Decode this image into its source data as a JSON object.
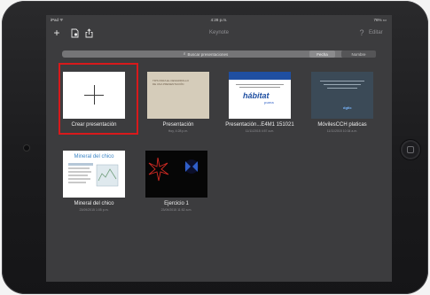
{
  "status_bar": {
    "device": "iPad ᯤ",
    "time": "4:28 p.m.",
    "battery": "76% ▭"
  },
  "toolbar": {
    "title": "Keynote",
    "edit_label": "Editar",
    "help_label": "?"
  },
  "search": {
    "placeholder": "Buscar presentaciones",
    "sort_options": [
      "Fecha",
      "Nombre"
    ],
    "selected_sort": "Fecha"
  },
  "presentations": [
    {
      "name": "Crear presentación",
      "date": ""
    },
    {
      "name": "Presentación",
      "date": "Hoy, 4:28 p.m.",
      "thumb_title": "TIPS PARA EL DESARROLLO DE UNA PRESENTACIÓN"
    },
    {
      "name": "Presentación...E4M1 151021",
      "date": "11/11/2015 4:57 a.m.",
      "thumb_logo": "hábitat",
      "thumb_logo2": "puma"
    },
    {
      "name": "MóvilesCCH platicas",
      "date": "11/11/2015 10:34 a.m.",
      "thumb_logo": "dgtic"
    },
    {
      "name": "Mineral del chico",
      "date": "23/09/2015 1:05 p.m.",
      "thumb_title": "Mineral del chico"
    },
    {
      "name": "Ejercicio 1",
      "date": "23/09/2015 11:52 a.m."
    }
  ],
  "colors": {
    "screen_bg": "#3c3c3e",
    "highlight": "#d8191b"
  }
}
